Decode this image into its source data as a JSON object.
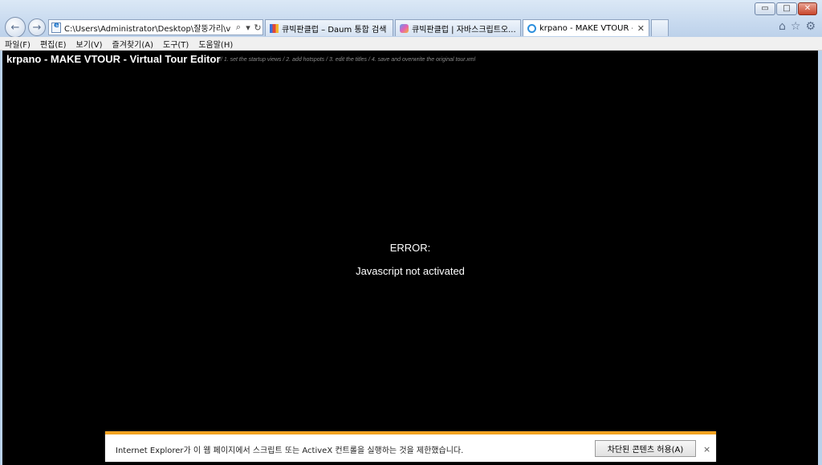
{
  "window": {
    "minimize_glyph": "▭",
    "maximize_glyph": "□",
    "close_glyph": "✕"
  },
  "address_bar": {
    "url": "C:\\Users\\Administrator\\Desktop\\잘뚱가리\\v",
    "search_glyph": "⌕",
    "dropdown_glyph": "▾",
    "refresh_glyph": "↻"
  },
  "tabs": [
    {
      "label": "큐빅판클럽 – Daum 통합 검색",
      "icon": "daum-favicon"
    },
    {
      "label": "큐빅판클럽 | 자바스크립트오...",
      "icon": "site-favicon"
    },
    {
      "label": "krpano - MAKE VTOUR - V...",
      "icon": "ie-favicon",
      "close": "✕"
    }
  ],
  "toolbar_icons": {
    "home": "⌂",
    "favorites": "☆",
    "tools": "⚙"
  },
  "menu": [
    "파일(F)",
    "편집(E)",
    "보기(V)",
    "즐겨찾기(A)",
    "도구(T)",
    "도움말(H)"
  ],
  "page": {
    "title": "krpano - MAKE VTOUR - Virtual Tour Editor",
    "steps": "// 1. set the startup views / 2. add hotspots / 3. edit the titles / 4. save and overwrite the original tour.xml",
    "error_heading": "ERROR:",
    "error_message": "Javascript not activated"
  },
  "notification": {
    "message": "Internet Explorer가 이 웹 페이지에서 스크립트 또는 ActiveX 컨트롤을 실행하는 것을 제한했습니다.",
    "button": "차단된 콘텐츠 허용(A)",
    "close": "×",
    "accent_color": "#f2a320"
  }
}
